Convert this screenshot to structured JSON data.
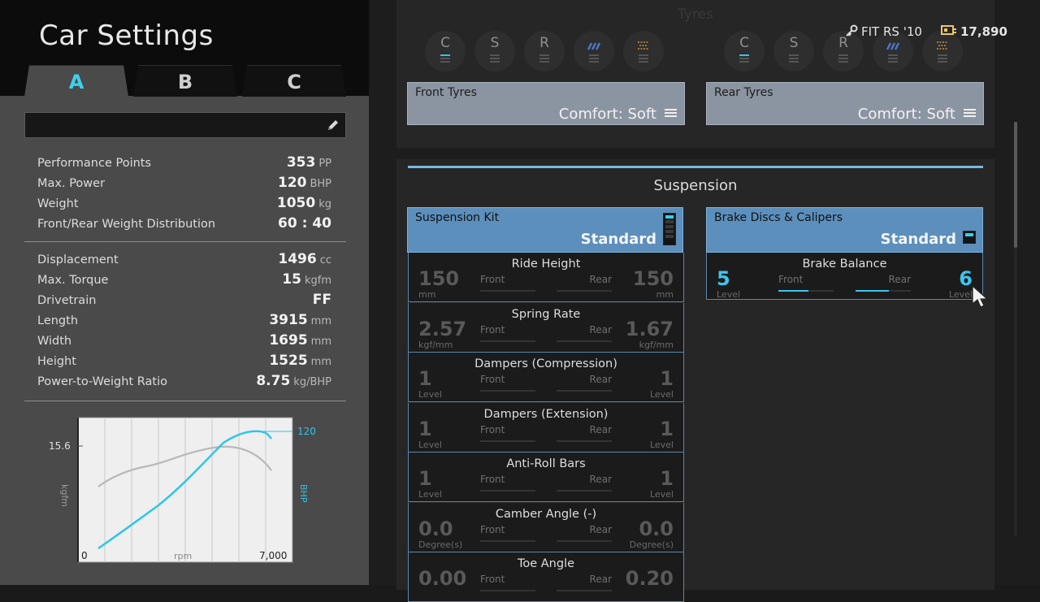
{
  "header": {
    "title": "Car Settings"
  },
  "setting_tabs": [
    {
      "label": "A",
      "active": true
    },
    {
      "label": "B",
      "active": false
    },
    {
      "label": "C",
      "active": false
    }
  ],
  "car": {
    "name": "FIT RS '10",
    "credits": "17,890"
  },
  "specs_group1": [
    {
      "label": "Performance Points",
      "value": "353",
      "unit": "PP"
    },
    {
      "label": "Max. Power",
      "value": "120",
      "unit": "BHP"
    },
    {
      "label": "Weight",
      "value": "1050",
      "unit": "kg"
    },
    {
      "label": "Front/Rear Weight Distribution",
      "value": "60 : 40",
      "unit": ""
    }
  ],
  "specs_group2": [
    {
      "label": "Displacement",
      "value": "1496",
      "unit": "cc"
    },
    {
      "label": "Max. Torque",
      "value": "15",
      "unit": "kgfm"
    },
    {
      "label": "Drivetrain",
      "value": "FF",
      "unit": ""
    },
    {
      "label": "Length",
      "value": "3915",
      "unit": "mm"
    },
    {
      "label": "Width",
      "value": "1695",
      "unit": "mm"
    },
    {
      "label": "Height",
      "value": "1525",
      "unit": "mm"
    },
    {
      "label": "Power-to-Weight Ratio",
      "value": "8.75",
      "unit": "kg/BHP"
    }
  ],
  "graph": {
    "torque_peak_label": "15.6",
    "power_peak_label": "120",
    "x_min_label": "0",
    "x_label": "rpm",
    "x_max_label": "7,000",
    "y_left_label": "kgfm",
    "y_right_label": "BHP",
    "torque_color": "#b9b9b9",
    "power_color": "#2fc6e6"
  },
  "tyres": {
    "title": "Tyres",
    "compound_icons_front": [
      {
        "letter": "C",
        "icon": "comfort-letter",
        "active": true
      },
      {
        "letter": "S",
        "icon": "sports-letter",
        "active": false
      },
      {
        "letter": "R",
        "icon": "racing-letter",
        "active": false
      },
      {
        "letter": "",
        "icon": "rain-icon",
        "active": false
      },
      {
        "letter": "",
        "icon": "dirt-icon",
        "active": false
      }
    ],
    "compound_icons_rear": [
      {
        "letter": "C",
        "icon": "comfort-letter",
        "active": true
      },
      {
        "letter": "S",
        "icon": "sports-letter",
        "active": false
      },
      {
        "letter": "R",
        "icon": "racing-letter",
        "active": false
      },
      {
        "letter": "",
        "icon": "rain-icon",
        "active": false
      },
      {
        "letter": "",
        "icon": "dirt-icon",
        "active": false
      }
    ],
    "front": {
      "label": "Front Tyres",
      "value": "Comfort: Soft"
    },
    "rear": {
      "label": "Rear Tyres",
      "value": "Comfort: Soft"
    }
  },
  "suspension": {
    "title": "Suspension",
    "kit": {
      "label": "Suspension Kit",
      "value": "Standard"
    },
    "brakes": {
      "label": "Brake Discs & Calipers",
      "value": "Standard"
    },
    "brake_balance": {
      "title": "Brake Balance",
      "front_label": "Front",
      "rear_label": "Rear",
      "front_value": "5",
      "rear_value": "6",
      "front_unit": "Level",
      "rear_unit": "Level",
      "front_fill": 0.55,
      "rear_fill": 0.6
    },
    "params": [
      {
        "title": "Ride Height",
        "front_label": "Front",
        "rear_label": "Rear",
        "front_value": "150",
        "rear_value": "150",
        "front_unit": "mm",
        "rear_unit": "mm"
      },
      {
        "title": "Spring Rate",
        "front_label": "Front",
        "rear_label": "Rear",
        "front_value": "2.57",
        "rear_value": "1.67",
        "front_unit": "kgf/mm",
        "rear_unit": "kgf/mm"
      },
      {
        "title": "Dampers (Compression)",
        "front_label": "Front",
        "rear_label": "Rear",
        "front_value": "1",
        "rear_value": "1",
        "front_unit": "Level",
        "rear_unit": "Level"
      },
      {
        "title": "Dampers (Extension)",
        "front_label": "Front",
        "rear_label": "Rear",
        "front_value": "1",
        "rear_value": "1",
        "front_unit": "Level",
        "rear_unit": "Level"
      },
      {
        "title": "Anti-Roll Bars",
        "front_label": "Front",
        "rear_label": "Rear",
        "front_value": "1",
        "rear_value": "1",
        "front_unit": "Level",
        "rear_unit": "Level"
      },
      {
        "title": "Camber Angle (-)",
        "front_label": "Front",
        "rear_label": "Rear",
        "front_value": "0.0",
        "rear_value": "0.0",
        "front_unit": "Degree(s)",
        "rear_unit": "Degree(s)"
      },
      {
        "title": "Toe Angle",
        "front_label": "Front",
        "rear_label": "Rear",
        "front_value": "0.00",
        "rear_value": "0.20",
        "front_unit": "",
        "rear_unit": ""
      }
    ]
  }
}
